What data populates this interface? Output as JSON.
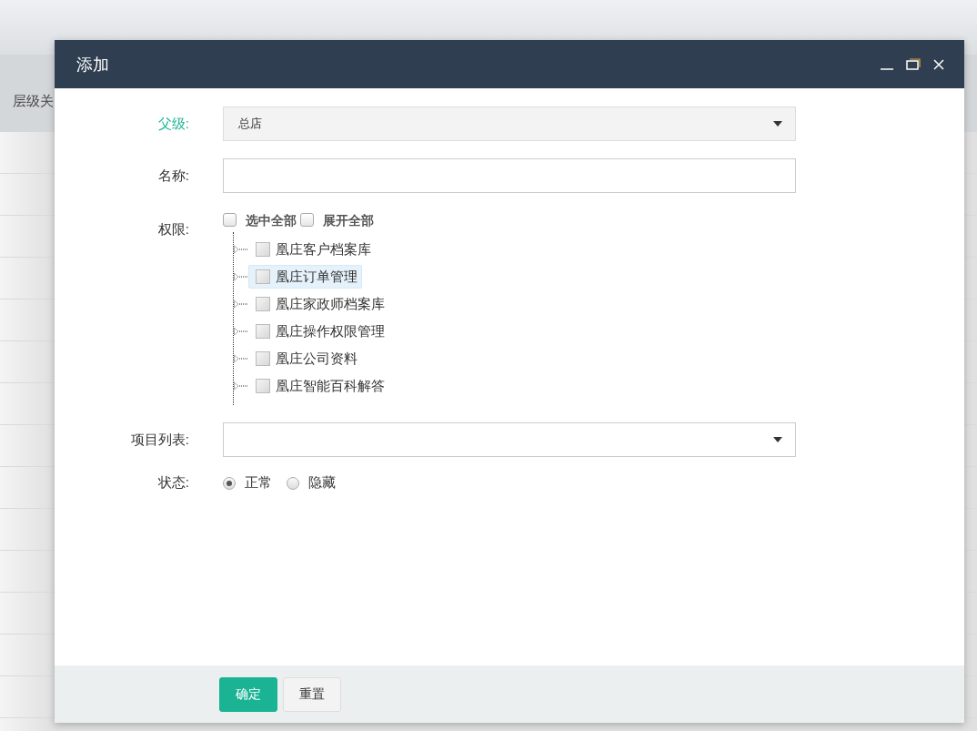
{
  "background": {
    "table_header": "层级关"
  },
  "dialog": {
    "title": "添加",
    "fields": [
      {
        "kind": "select",
        "label": "父级:",
        "focused": true,
        "value": "总店"
      },
      {
        "kind": "text",
        "label": "名称:",
        "focused": false
      },
      {
        "kind": "tree",
        "label": "权限:",
        "focused": false,
        "options": [
          {
            "label": "选中全部",
            "checked": false
          },
          {
            "label": "展开全部",
            "checked": false
          }
        ],
        "items": [
          {
            "label": "凰庄客户档案库",
            "checked": false,
            "selected": false,
            "expanded": false
          },
          {
            "label": "凰庄订单管理",
            "checked": false,
            "selected": true,
            "expanded": false
          },
          {
            "label": "凰庄家政师档案库",
            "checked": false,
            "selected": false,
            "expanded": false
          },
          {
            "label": "凰庄操作权限管理",
            "checked": false,
            "selected": false,
            "expanded": false
          },
          {
            "label": "凰庄公司资料",
            "checked": false,
            "selected": false,
            "expanded": false
          },
          {
            "label": "凰庄智能百科解答",
            "checked": false,
            "selected": false,
            "expanded": false
          }
        ]
      },
      {
        "kind": "select",
        "label": "项目列表:",
        "focused": false
      },
      {
        "kind": "radio",
        "label": "状态:",
        "focused": false,
        "options": [
          {
            "label": "正常",
            "selected": true
          },
          {
            "label": "隐藏",
            "selected": false
          }
        ]
      }
    ],
    "buttons": [
      {
        "label": "确定",
        "kind": "primary"
      },
      {
        "label": "重置",
        "kind": "default"
      }
    ]
  }
}
